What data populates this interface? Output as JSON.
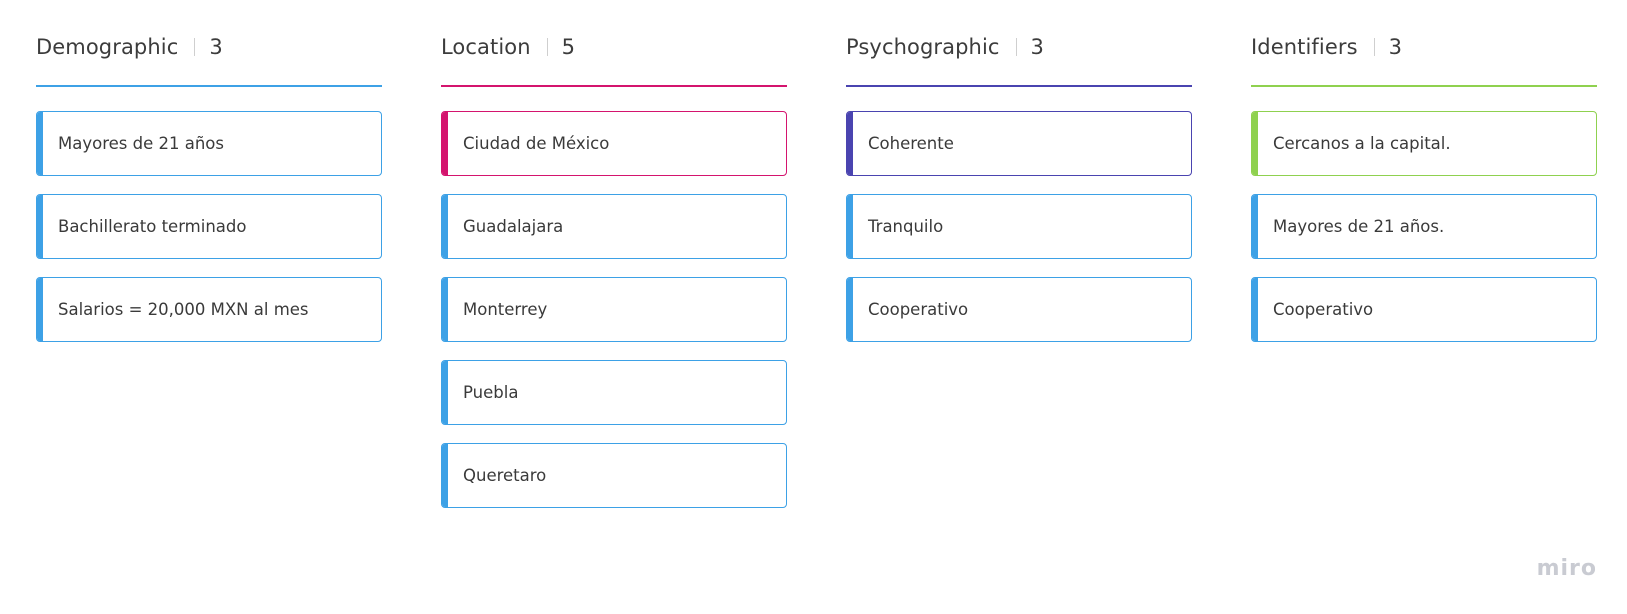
{
  "board": {
    "columns": [
      {
        "title": "Demographic",
        "count": "3",
        "accent": "#3da1e6",
        "cards": [
          {
            "text": "Mayores de 21 años",
            "accent": "#3da1e6",
            "border": "#3da1e6"
          },
          {
            "text": "Bachillerato terminado",
            "accent": "#3da1e6",
            "border": "#3da1e6"
          },
          {
            "text": "Salarios = 20,000 MXN al mes",
            "accent": "#3da1e6",
            "border": "#3da1e6"
          }
        ]
      },
      {
        "title": "Location",
        "count": "5",
        "accent": "#d4146e",
        "cards": [
          {
            "text": "Ciudad de México",
            "accent": "#d4146e",
            "border": "#d4146e"
          },
          {
            "text": "Guadalajara",
            "accent": "#3da1e6",
            "border": "#3da1e6"
          },
          {
            "text": "Monterrey",
            "accent": "#3da1e6",
            "border": "#3da1e6"
          },
          {
            "text": "Puebla",
            "accent": "#3da1e6",
            "border": "#3da1e6"
          },
          {
            "text": "Queretaro",
            "accent": "#3da1e6",
            "border": "#3da1e6"
          }
        ]
      },
      {
        "title": "Psychographic",
        "count": "3",
        "accent": "#4a44b0",
        "cards": [
          {
            "text": "Coherente",
            "accent": "#4a44b0",
            "border": "#4a44b0"
          },
          {
            "text": "Tranquilo",
            "accent": "#3da1e6",
            "border": "#3da1e6"
          },
          {
            "text": "Cooperativo",
            "accent": "#3da1e6",
            "border": "#3da1e6"
          }
        ]
      },
      {
        "title": "Identifiers",
        "count": "3",
        "accent": "#8fd14f",
        "cards": [
          {
            "text": "Cercanos a la capital.",
            "accent": "#8fd14f",
            "border": "#8fd14f"
          },
          {
            "text": "Mayores de 21 años.",
            "accent": "#3da1e6",
            "border": "#3da1e6"
          },
          {
            "text": "Cooperativo",
            "accent": "#3da1e6",
            "border": "#3da1e6"
          }
        ]
      }
    ]
  },
  "brand": {
    "label": "miro"
  }
}
